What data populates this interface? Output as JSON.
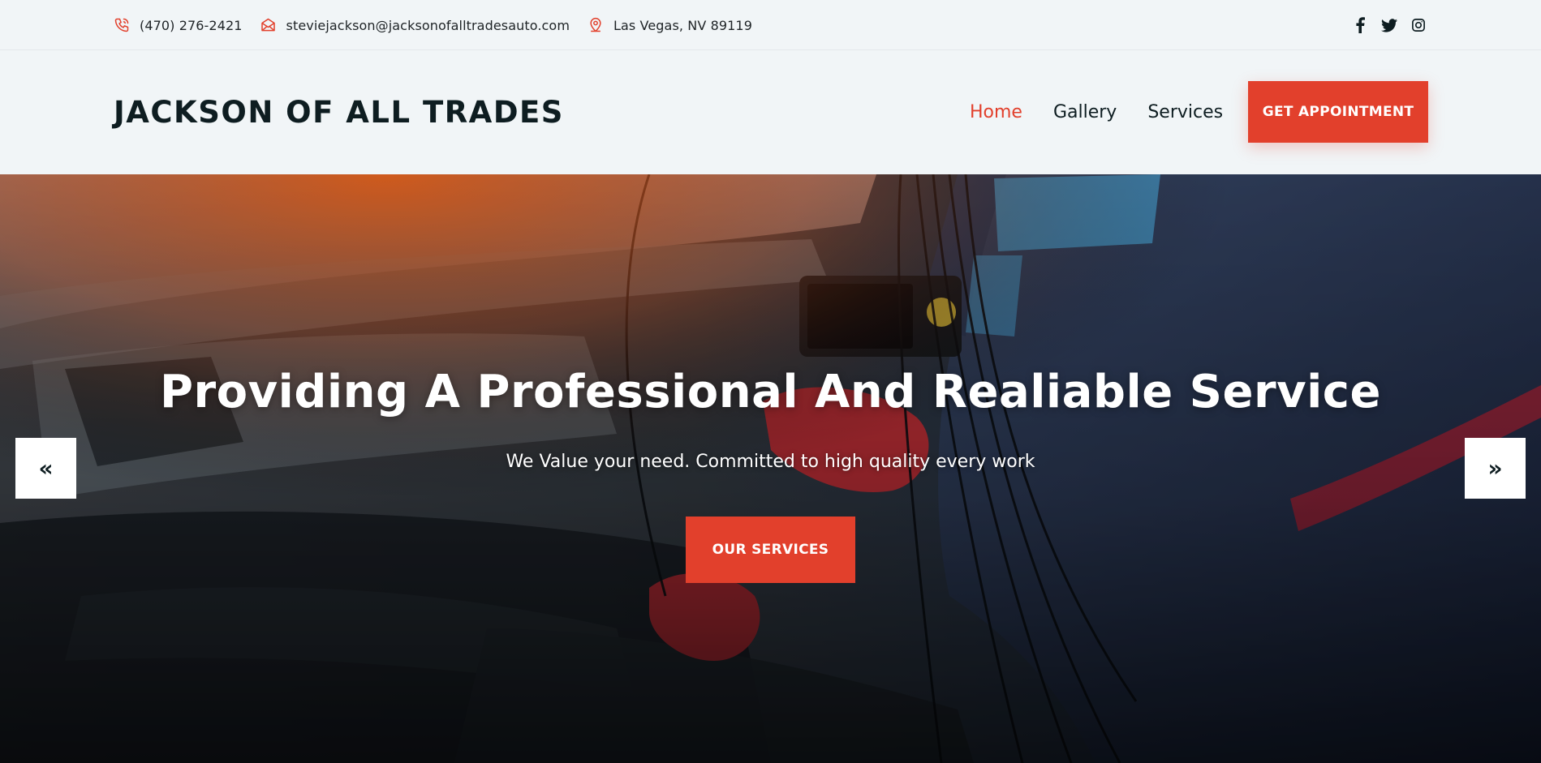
{
  "topbar": {
    "phone": "(470) 276-2421",
    "email": "steviejackson@jacksonofalltradesauto.com",
    "location": "Las Vegas, NV 89119",
    "icons": [
      "phone-icon",
      "envelope-icon",
      "map-pin-icon"
    ],
    "social": [
      "facebook-icon",
      "twitter-icon",
      "instagram-icon"
    ]
  },
  "header": {
    "brand": "JACKSON OF ALL TRADES",
    "nav": [
      {
        "label": "Home",
        "active": true
      },
      {
        "label": "Gallery",
        "active": false
      },
      {
        "label": "Services",
        "active": false
      }
    ],
    "cta_label": "GET APPOINTMENT"
  },
  "hero": {
    "title": "Providing A Professional And Realiable Service",
    "subtitle": "We Value your need. Committed to high quality every work",
    "button_label": "OUR SERVICES",
    "prev_label": "«",
    "next_label": "»"
  },
  "colors": {
    "accent": "#e2402c",
    "dark": "#0e1d21",
    "background": "#f1f5f7"
  }
}
